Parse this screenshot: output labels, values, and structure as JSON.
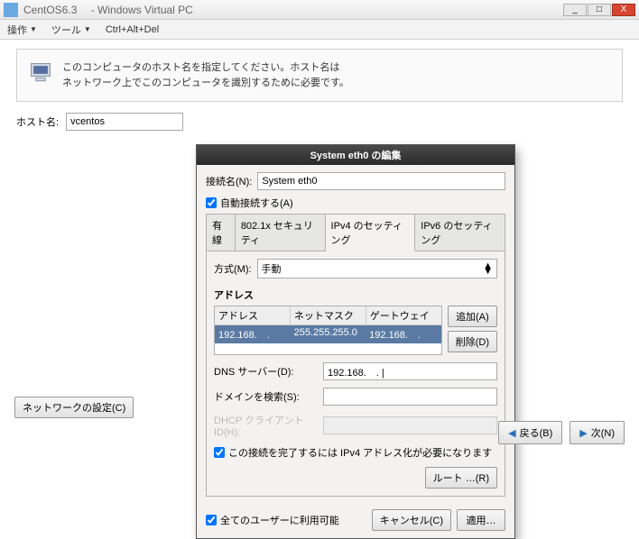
{
  "window": {
    "title": "CentOS6.3 　- Windows Virtual PC",
    "menu": {
      "action": "操作",
      "tool": "ツール",
      "cad": "Ctrl+Alt+Del"
    },
    "winbtns": {
      "min": "_",
      "max": "□",
      "close": "X"
    }
  },
  "host": {
    "line1": "このコンピュータのホスト名を指定してください。ホスト名は",
    "line2": "ネットワーク上でこのコンピュータを識別するために必要です。",
    "label": "ホスト名:",
    "value": "vcentos"
  },
  "netcfg_btn": "ネットワークの設定(C)",
  "dialog": {
    "title": "System eth0 の編集",
    "conn_label": "接続名(N):",
    "conn_value": "System eth0",
    "autoconn": "自動接続する(A)",
    "tabs": {
      "wired": "有線",
      "sec": "802.1x セキュリティ",
      "ipv4": "IPv4 のセッティング",
      "ipv6": "IPv6 のセッティング"
    },
    "method_label": "方式(M):",
    "method_value": "手動",
    "addr_title": "アドレス",
    "addr_hdr": {
      "addr": "アドレス",
      "mask": "ネットマスク",
      "gw": "ゲートウェイ"
    },
    "addr_row": {
      "addr": "192.168.　.",
      "mask": "255.255.255.0",
      "gw": "192.168.　."
    },
    "add_btn": "追加(A)",
    "del_btn": "削除(D)",
    "dns_label": "DNS サーバー(D):",
    "dns_value": "192.168.　. |",
    "domain_label": "ドメインを検索(S):",
    "domain_value": "",
    "dhcp_label": "DHCP クライアント ID(H):",
    "dhcp_value": "",
    "require_ipv4": "この接続を完了するには IPv4 アドレス化が必要になります",
    "routes_btn": "ルート …(R)",
    "all_users": "全てのユーザーに利用可能",
    "cancel_btn": "キャンセル(C)",
    "apply_btn": "適用…"
  },
  "nav": {
    "back": "戻る(B)",
    "next": "次(N)"
  }
}
